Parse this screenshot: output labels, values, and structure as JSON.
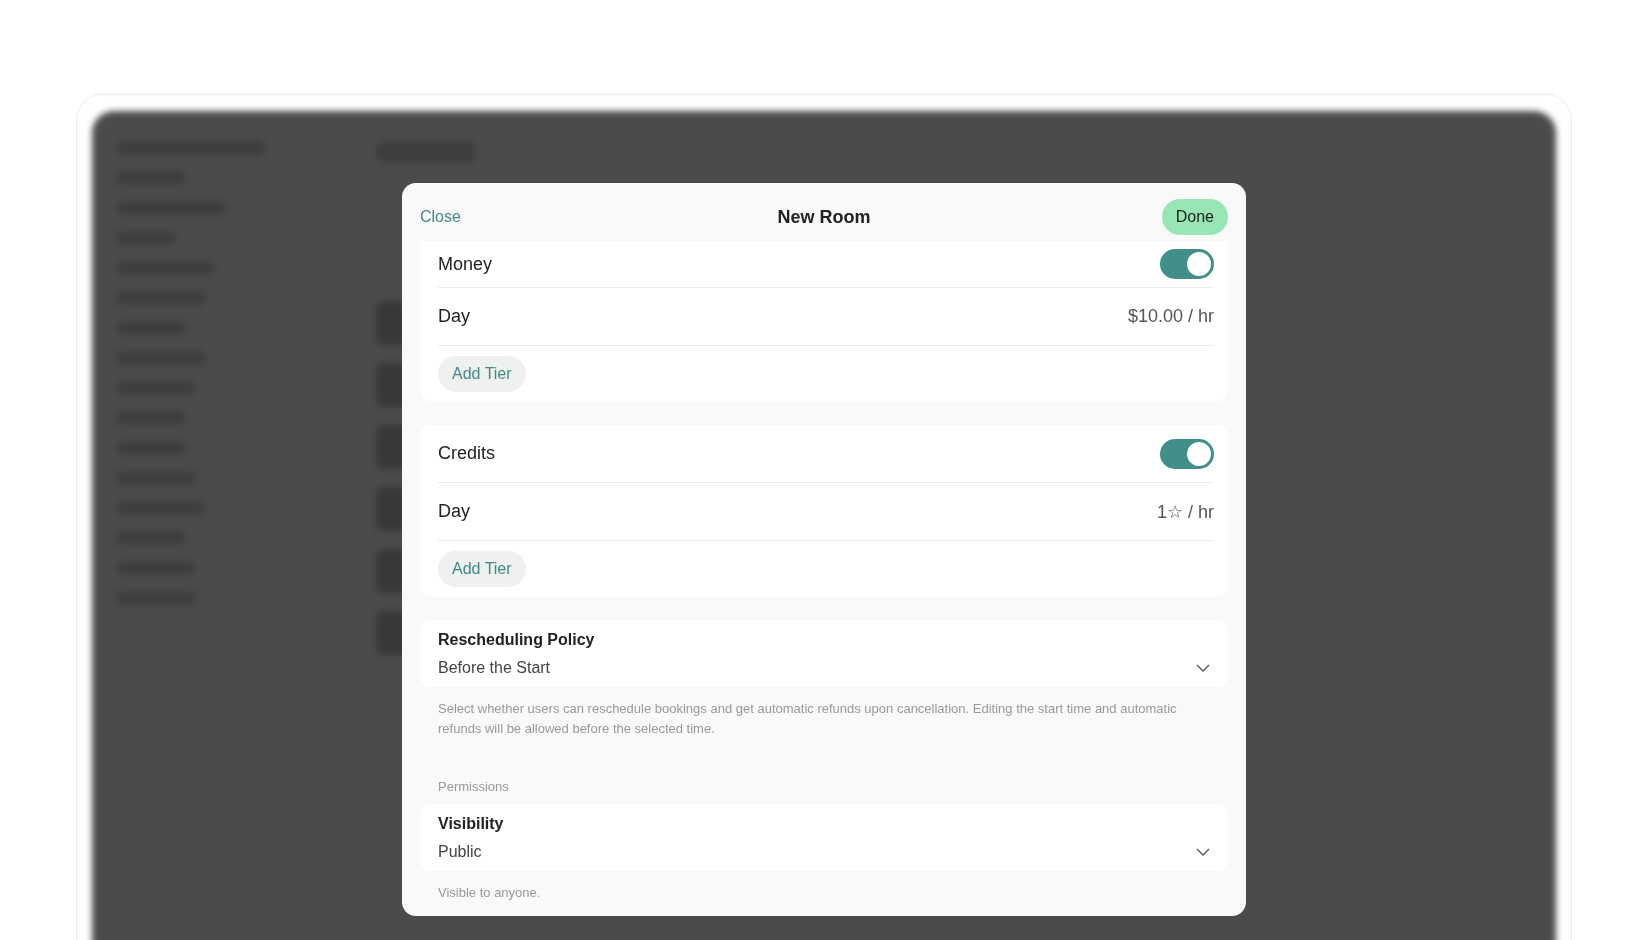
{
  "modal": {
    "title": "New Room",
    "close_label": "Close",
    "done_label": "Done"
  },
  "pricing": [
    {
      "title": "Money",
      "enabled": true,
      "tiers": [
        {
          "label": "Day",
          "value": "$10.00 / hr"
        }
      ],
      "add_label": "Add Tier"
    },
    {
      "title": "Credits",
      "enabled": true,
      "tiers": [
        {
          "label": "Day",
          "value": "1☆ / hr"
        }
      ],
      "add_label": "Add Tier"
    }
  ],
  "rescheduling": {
    "label": "Rescheduling Policy",
    "value": "Before the Start",
    "help": "Select whether users can reschedule bookings and get automatic refunds upon cancellation. Editing the start time and automatic refunds will be allowed before the selected time."
  },
  "permissions": {
    "heading": "Permissions",
    "label": "Visibility",
    "value": "Public",
    "help": "Visible to anyone."
  }
}
